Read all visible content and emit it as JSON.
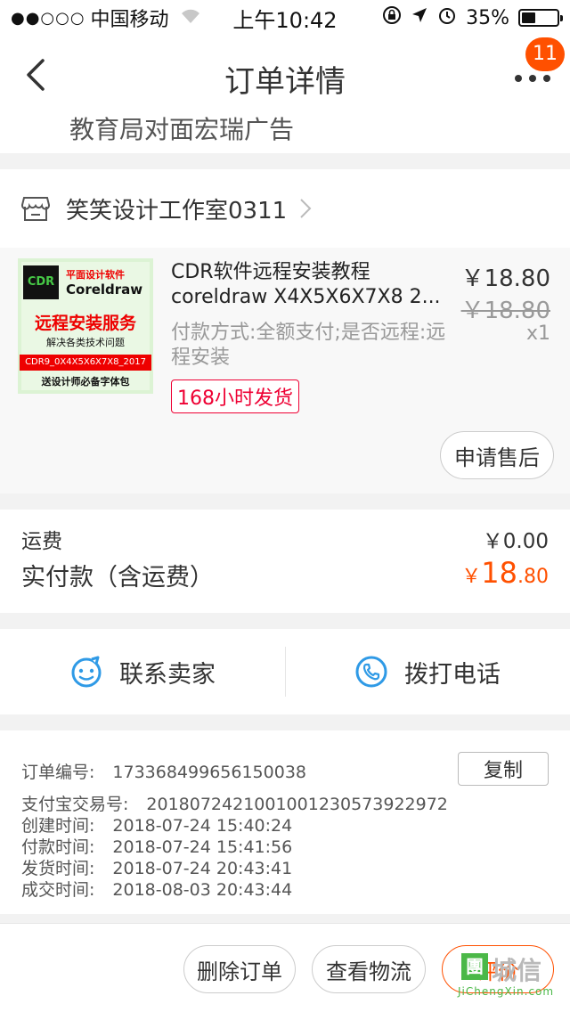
{
  "status_bar": {
    "signal": "●●○○○",
    "carrier": "中国移动",
    "time": "上午10:42",
    "battery_text": "35%",
    "battery_level": 0.35
  },
  "nav": {
    "title": "订单详情",
    "badge": "11",
    "back_icon": "chevron-left-icon",
    "more_icon": "more-dots-icon"
  },
  "address_tail": "教育局对面宏瑞广告",
  "shop": {
    "name": "笑笑设计工作室0311"
  },
  "item": {
    "thumb": {
      "logo": "CDR",
      "line1": "平面设计软件",
      "line2": "Coreldraw",
      "line3": "远程安装服务",
      "line4": "解决各类技术问题",
      "line5": "CDR9_0X4X5X6X7X8_2017",
      "line6": "送设计师必备字体包"
    },
    "title_line1": "CDR软件远程安装教程",
    "title_line2": "coreldraw X4X5X6X7X8 2...",
    "sku": "付款方式:全额支付;是否远程:远程安装",
    "price": "￥18.80",
    "original_price": "￥18.80",
    "qty": "x1",
    "tag": "168小时发货",
    "after_sale_label": "申请售后"
  },
  "fees": {
    "shipping_label": "运费",
    "shipping_value": "￥0.00",
    "paid_label": "实付款（含运费）",
    "paid_yen": "￥",
    "paid_int": "18",
    "paid_dec": ".80",
    "accent": "#ff5000"
  },
  "contact": {
    "seller_label": "联系卖家",
    "seller_icon": "chat-face-icon",
    "phone_label": "拨打电话",
    "phone_icon": "phone-icon"
  },
  "order_info": {
    "copy_label": "复制",
    "rows": [
      {
        "key": "订单编号:",
        "value": "173368499656150038"
      },
      {
        "key": "支付宝交易号:",
        "value": "2018072421001001230573922972"
      },
      {
        "key": "创建时间:",
        "value": "2018-07-24 15:40:24"
      },
      {
        "key": "付款时间:",
        "value": "2018-07-24 15:41:56"
      },
      {
        "key": "发货时间:",
        "value": "2018-07-24 20:43:41"
      },
      {
        "key": "成交时间:",
        "value": "2018-08-03 20:43:44"
      }
    ]
  },
  "footer": {
    "delete_label": "删除订单",
    "logistics_label": "查看物流",
    "rate_label": "评价"
  },
  "watermark": {
    "box": "團",
    "big": "城信",
    "small": "JiChengXin.com"
  }
}
